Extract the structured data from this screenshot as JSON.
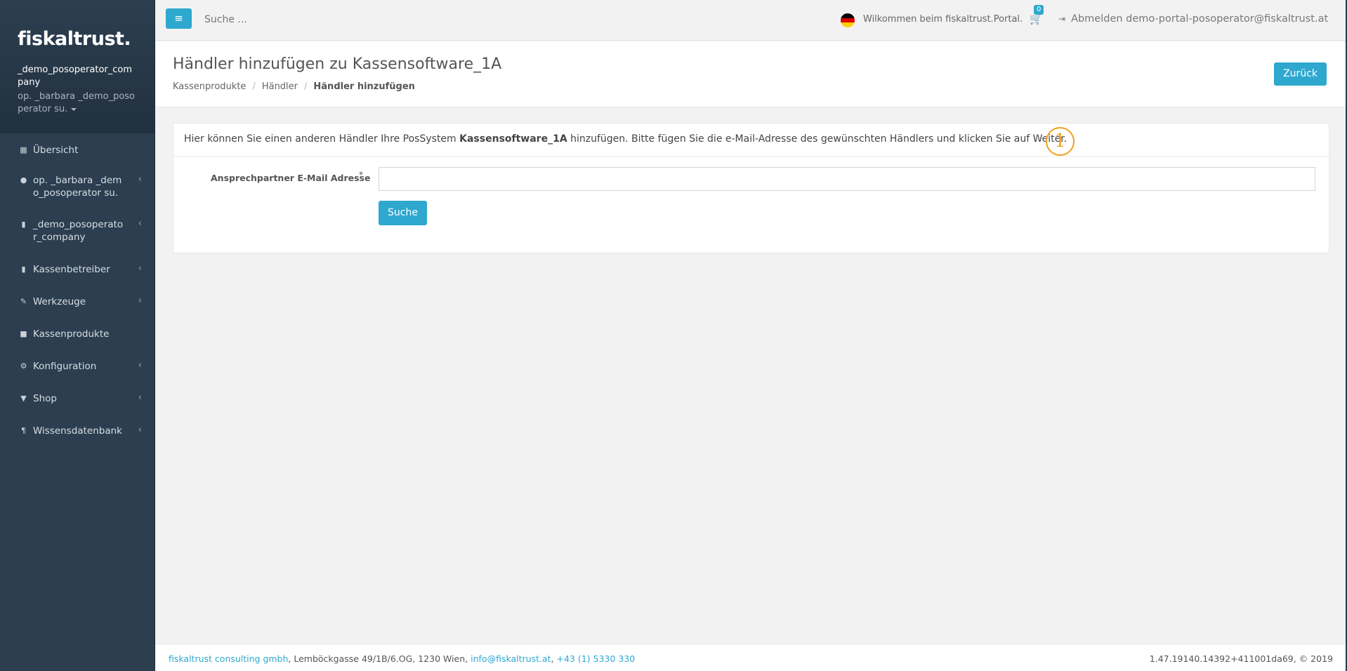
{
  "sidebar": {
    "logo": "fiskaltrust.",
    "company": "_demo_posoperator_company",
    "user": "op. _barbara _demo_posoperator su.",
    "items": [
      {
        "icon": "dashboard-icon",
        "label": "Übersicht",
        "has_submenu": false
      },
      {
        "icon": "user-icon",
        "label": "op. _barbara _demo_posoperator su.",
        "has_submenu": true
      },
      {
        "icon": "building-icon",
        "label": "_demo_posoperator_company",
        "has_submenu": true
      },
      {
        "icon": "building-icon",
        "label": "Kassenbetreiber",
        "has_submenu": true
      },
      {
        "icon": "wrench-icon",
        "label": "Werkzeuge",
        "has_submenu": true
      },
      {
        "icon": "briefcase-icon",
        "label": "Kassenprodukte",
        "has_submenu": false
      },
      {
        "icon": "cogs-icon",
        "label": "Konfiguration",
        "has_submenu": true
      },
      {
        "icon": "basket-icon",
        "label": "Shop",
        "has_submenu": true
      },
      {
        "icon": "paragraph-icon",
        "label": "Wissensdatenbank",
        "has_submenu": true
      }
    ]
  },
  "topbar": {
    "search_placeholder": "Suche ...",
    "welcome": "Wilkommen beim fiskaltrust.Portal.",
    "cart_count": "0",
    "logout": "Abmelden demo-portal-posoperator@fiskaltrust.at"
  },
  "header": {
    "title": "Händler hinzufügen zu Kassensoftware_1A",
    "back_button": "Zurück",
    "breadcrumb": [
      "Kassenprodukte",
      "Händler",
      "Händler hinzufügen"
    ]
  },
  "panel": {
    "intro_prefix": "Hier können Sie einen anderen Händler Ihre PosSystem ",
    "intro_product": "Kassensoftware_1A",
    "intro_suffix": " hinzufügen. Bitte fügen Sie die e-Mail-Adresse des gewünschten Händlers und klicken Sie auf Weiter.",
    "marker": "1",
    "email_label": "Ansprechpartner E-Mail Adresse",
    "required_mark": "*",
    "email_value": "",
    "search_button": "Suche"
  },
  "footer": {
    "company_link": "fiskaltrust consulting gmbh",
    "address": ", Lemböckgasse 49/1B/6.OG, 1230 Wien, ",
    "email_link": "info@fiskaltrust.at",
    "separator": ", ",
    "phone_link": "+43 (1) 5330 330",
    "version": "1.47.19140.14392+411001da69, © 2019"
  },
  "colors": {
    "sidebar_bg": "#2c3e50",
    "accent": "#2ea8cf",
    "marker": "#f0a01e"
  }
}
